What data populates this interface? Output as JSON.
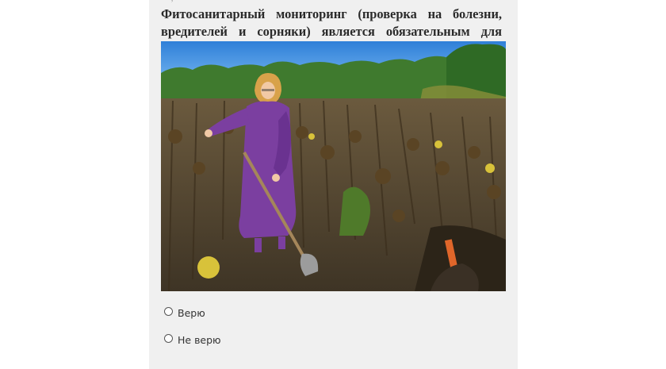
{
  "header": {
    "fragment": "· ,·",
    "title": "Фитосанитарный мониторинг (проверка на болезни, вредителей и сорняки) является обязательным для аграриев"
  },
  "quiz": {
    "options": [
      {
        "label": "Верю",
        "selected": false
      },
      {
        "label": "Не верю",
        "selected": false
      }
    ]
  },
  "colors": {
    "card_background": "#f0f0f0",
    "title_text": "#2a2a2a",
    "dress": "#7b3fa0",
    "sky": "#3f8fe0"
  },
  "icons": [
    "radio-unchecked-icon"
  ]
}
